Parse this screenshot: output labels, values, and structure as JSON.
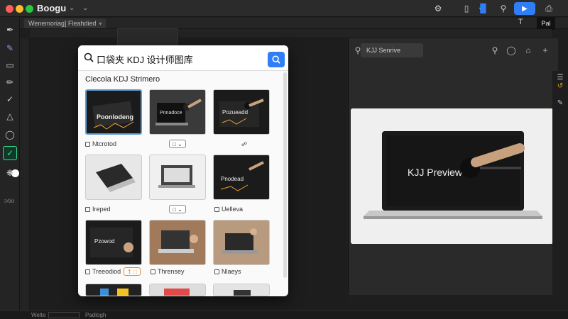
{
  "titlebar": {
    "app_name": "Boogu"
  },
  "tabs": {
    "active_label": "Wenemoriag] Fleahdied",
    "right_plus": "T",
    "right_pill": "Pal"
  },
  "toolbar": {
    "bottom_label": "⊃tio"
  },
  "modal": {
    "search_value": "口袋夹 KDJ 设计师图库",
    "heading": "Clecola KDJ Strimero",
    "items": [
      {
        "label": "Ntcrotod"
      },
      {
        "label": ""
      },
      {
        "label": ""
      },
      {
        "label": "Ireped"
      },
      {
        "label": ""
      },
      {
        "label": "Uelleva"
      },
      {
        "label": "Treeodiod"
      },
      {
        "label": "Thrensey"
      },
      {
        "label": "Nlaeys"
      }
    ],
    "card_texts": {
      "card1": "Poonlodeng",
      "card2": "Pnnadoce",
      "card3": "Pozueadd",
      "card6": "Pnodead",
      "card7": "Pzowod"
    }
  },
  "right_panel": {
    "search_label": "KJJ Senrive",
    "preview_text": "KJJ Preview"
  },
  "statusbar": {
    "item1": "Welte",
    "item2": "Padlogh"
  },
  "colors": {
    "accent": "#2f7ef6",
    "tool_active": "#3adb8c",
    "selection": "#e28a2d"
  }
}
